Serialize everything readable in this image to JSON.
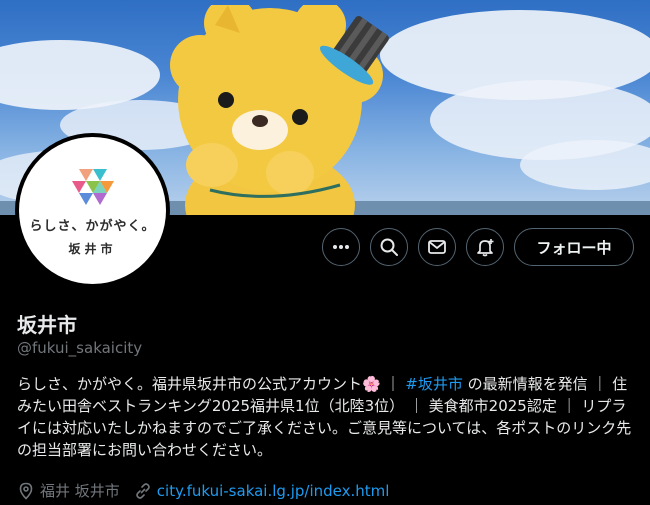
{
  "profile": {
    "display_name": "坂井市",
    "handle": "@fukui_sakaicity",
    "bio_part1": "らしさ、かがやく。福井県坂井市の公式アカウント",
    "bio_emoji": "🌸",
    "bio_sep1": " ｜ ",
    "hashtag": "#坂井市",
    "bio_part2": " の最新情報を発信 ｜ 住みたい田舎ベストランキング2025福井県1位（北陸3位） ｜ 美食都市2025認定 ｜ リプライには対応いたしかねますのでご了承ください。ご意見等については、各ポストのリンク先の担当部署にお問い合わせください。",
    "location": "福井 坂井市",
    "website": "city.fukui-sakai.lg.jp/index.html"
  },
  "avatar": {
    "tagline": "らしさ、かがやく。",
    "city": "坂井市"
  },
  "actions": {
    "more_icon": "more-dots-icon",
    "search_icon": "search-icon",
    "message_icon": "envelope-icon",
    "notify_icon": "bell-plus-icon",
    "follow_label": "フォロー中"
  },
  "colors": {
    "background": "#000000",
    "link": "#1d9bf0",
    "muted": "#71767b",
    "text": "#e7e9ea"
  }
}
